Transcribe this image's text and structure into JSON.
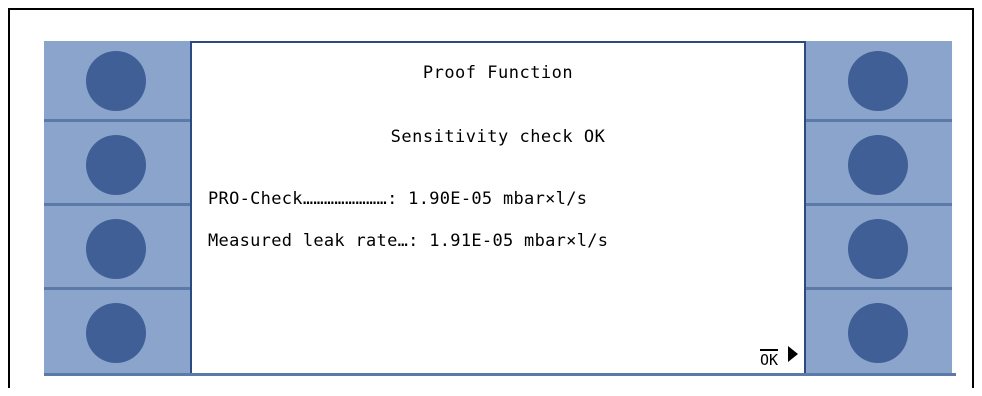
{
  "screen": {
    "title": "Proof Function",
    "status": "Sensitivity check OK",
    "rows": [
      {
        "label": "PRO-Check……………………: ",
        "value": "1.90E-05 mbar×l/s"
      },
      {
        "label": "Measured leak rate…: ",
        "value": "1.91E-05 mbar×l/s"
      }
    ],
    "ok_label": "OK"
  },
  "colors": {
    "side_panel": "#8aa4cb",
    "button": "#3f5f96",
    "divider": "#5b7aa8",
    "screen_border": "#2a4a80"
  }
}
